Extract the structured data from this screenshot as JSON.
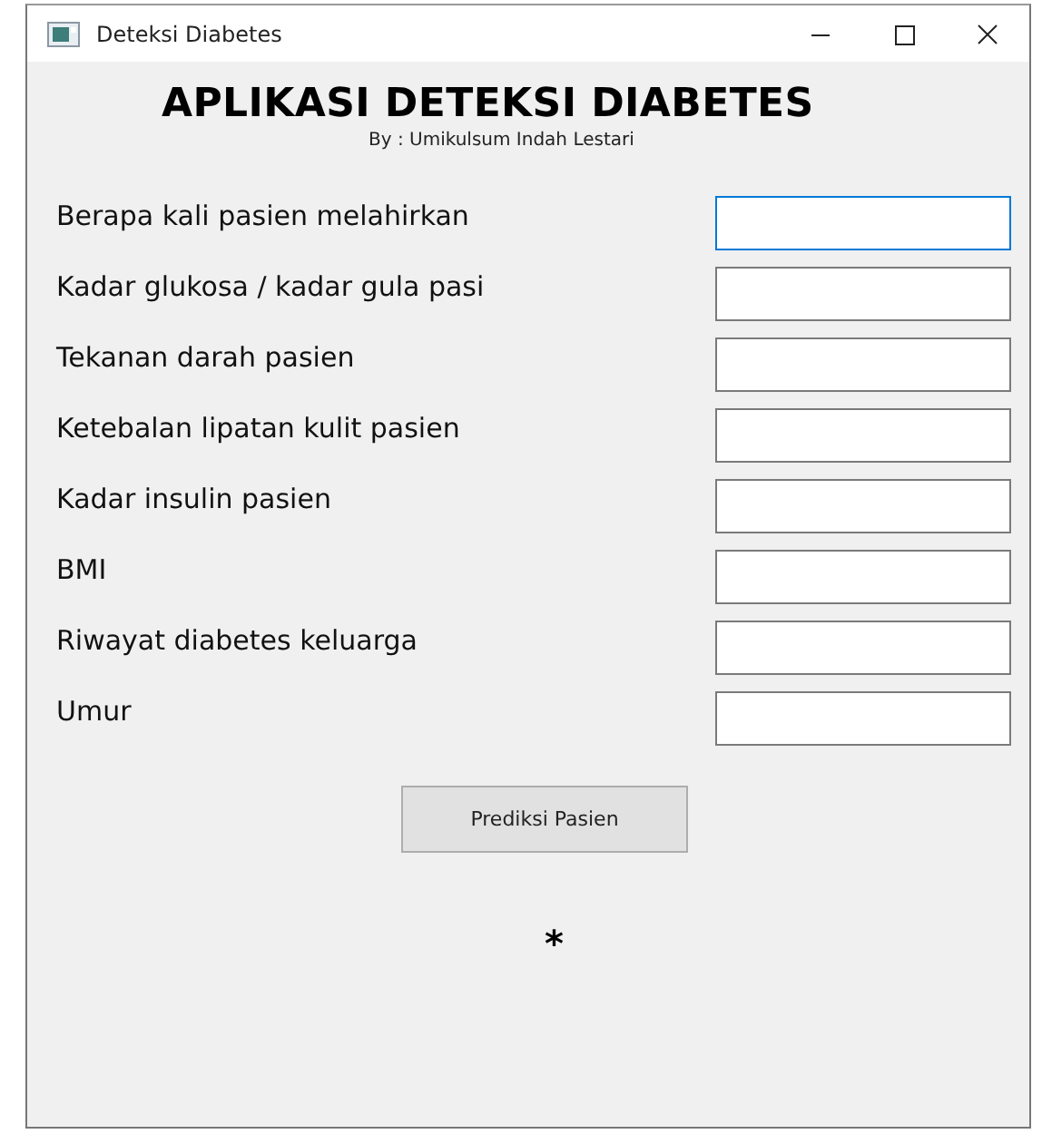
{
  "window": {
    "title": "Deteksi Diabetes"
  },
  "heading": "APLIKASI DETEKSI DIABETES",
  "subtitle": "By : Umikulsum Indah Lestari",
  "fields": [
    {
      "label": "Berapa kali pasien melahirkan",
      "focused": true
    },
    {
      "label": "Kadar glukosa / kadar gula pasi",
      "focused": false
    },
    {
      "label": "Tekanan darah pasien",
      "focused": false
    },
    {
      "label": "Ketebalan lipatan kulit pasien",
      "focused": false
    },
    {
      "label": "Kadar insulin pasien",
      "focused": false
    },
    {
      "label": "BMI",
      "focused": false
    },
    {
      "label": "Riwayat diabetes keluarga",
      "focused": false
    },
    {
      "label": "Umur",
      "focused": false
    }
  ],
  "button": "Prediksi Pasien",
  "result": "*"
}
